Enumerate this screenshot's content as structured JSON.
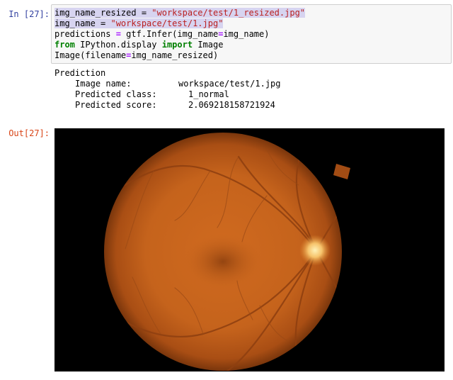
{
  "input_prompt": "In [27]:",
  "output_prompt": "Out[27]:",
  "code": {
    "line1": {
      "a": "img_name_resized",
      "b": " = ",
      "c": "\"workspace/test/1_resized.jpg\""
    },
    "line2": {
      "a": "img_name",
      "b": " = ",
      "c": "\"workspace/test/1.jpg\""
    },
    "line3": {
      "a": "predictions ",
      "b": "=",
      "c": " gtf.Infer(img_name",
      "d": "=",
      "e": "img_name)"
    },
    "line4": {
      "a": "from",
      "b": " IPython.display ",
      "c": "import",
      "d": " Image"
    },
    "line5": {
      "a": "Image(filename",
      "b": "=",
      "c": "img_name_resized)"
    }
  },
  "output": {
    "heading": "Prediction",
    "rows": [
      {
        "label": "Image name:",
        "value": "workspace/test/1.jpg"
      },
      {
        "label": "Predicted class:",
        "value": "1_normal"
      },
      {
        "label": "Predicted score:",
        "value": "2.069218158721924"
      }
    ]
  },
  "image": {
    "subject": "retinal fundus photograph",
    "background_color": "#000000",
    "fundus_color": "#c8661e"
  }
}
